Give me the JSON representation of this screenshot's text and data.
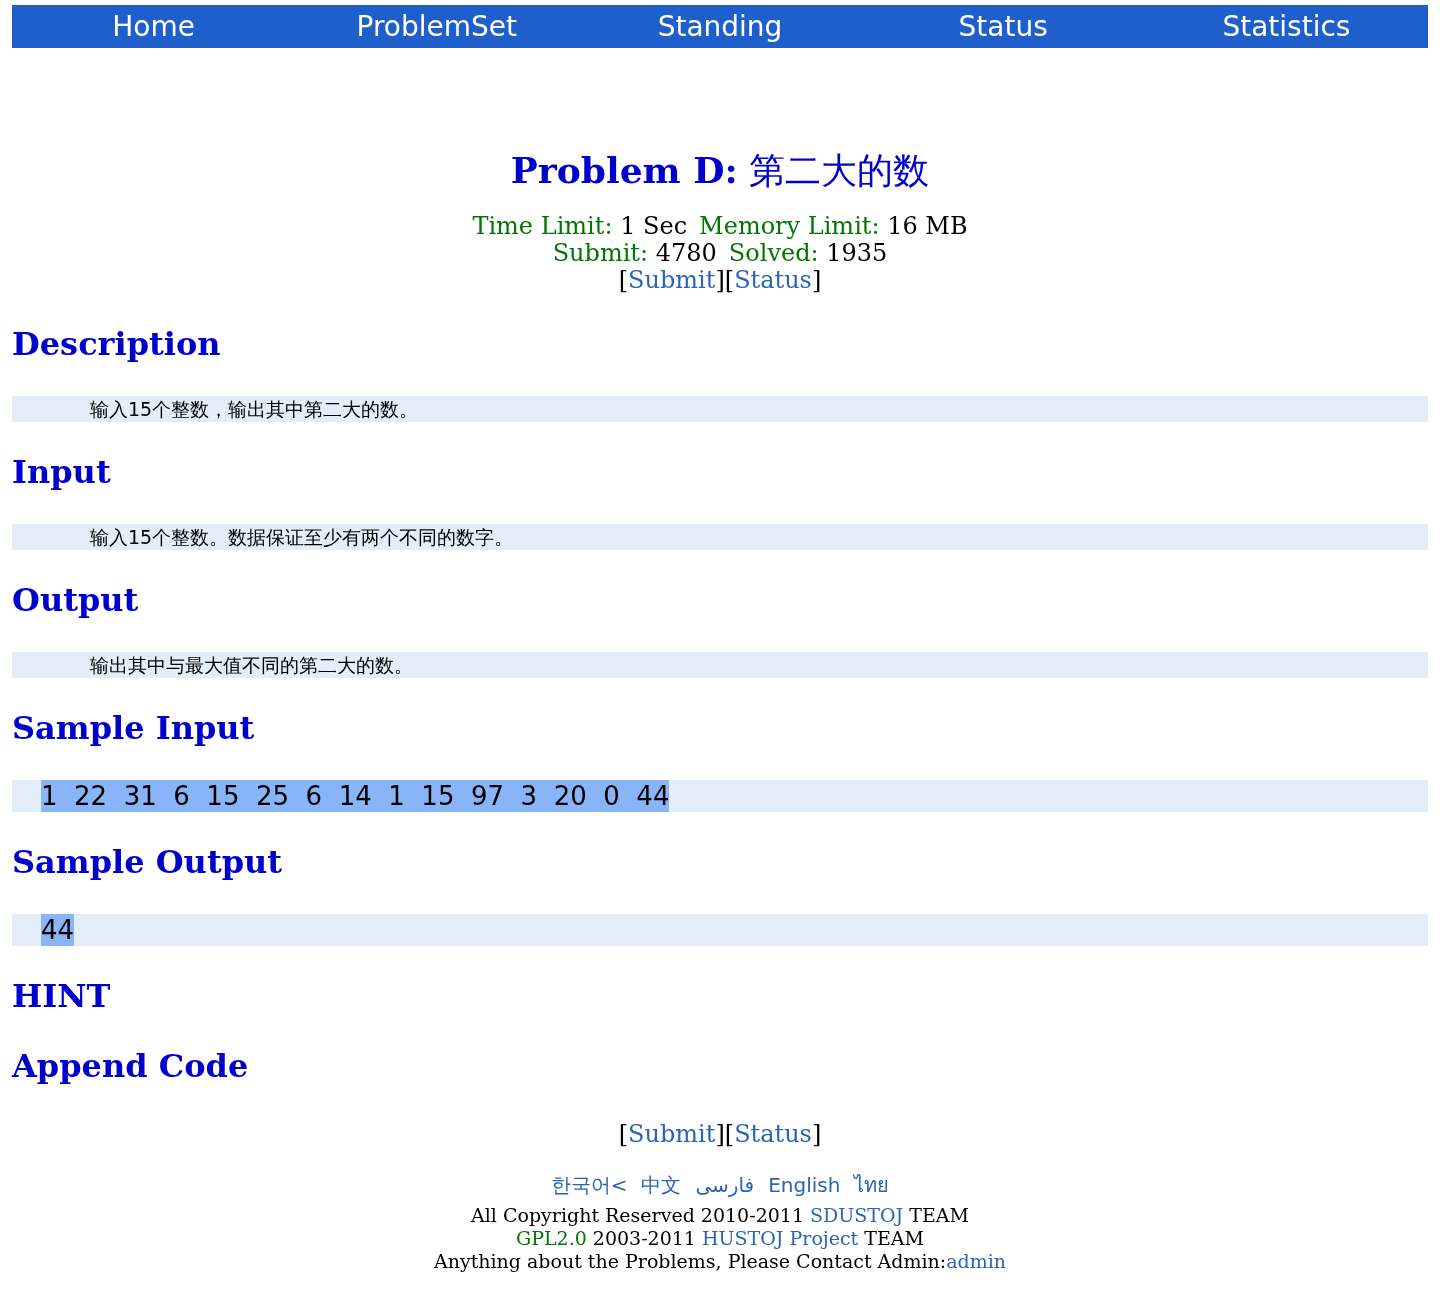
{
  "nav": [
    {
      "label": "Home"
    },
    {
      "label": "ProblemSet"
    },
    {
      "label": "Standing"
    },
    {
      "label": "Status"
    },
    {
      "label": "Statistics"
    }
  ],
  "problem": {
    "title_prefix": "Problem D:",
    "title": "第二大的数",
    "limits": [
      {
        "label": "Time Limit:",
        "value": "1 Sec"
      },
      {
        "label": "Memory Limit:",
        "value": "16 MB"
      }
    ],
    "counts": [
      {
        "label": "Submit:",
        "value": "4780"
      },
      {
        "label": "Solved:",
        "value": "1935"
      }
    ],
    "links": [
      {
        "kind": "bracket",
        "text": "["
      },
      {
        "kind": "link",
        "text": "Submit"
      },
      {
        "kind": "bracket",
        "text": "]["
      },
      {
        "kind": "link",
        "text": "Status"
      },
      {
        "kind": "bracket",
        "text": "]"
      }
    ]
  },
  "sections": [
    {
      "kind": "text",
      "heading": "Description",
      "body": "输入15个整数，输出其中第二大的数。"
    },
    {
      "kind": "text",
      "heading": "Input",
      "body": "输入15个整数。数据保证至少有两个不同的数字。"
    },
    {
      "kind": "text",
      "heading": "Output",
      "body": "输出其中与最大值不同的第二大的数。"
    },
    {
      "kind": "sample",
      "heading": "Sample Input",
      "body": "1  22  31  6  15  25  6  14  1  15  97  3  20  0  44",
      "highlighted": true
    },
    {
      "kind": "sample",
      "heading": "Sample Output",
      "body": "44",
      "highlighted": true
    },
    {
      "kind": "heading",
      "heading": "HINT"
    },
    {
      "kind": "heading",
      "heading": "Append Code"
    }
  ],
  "bottom_links": [
    {
      "kind": "bracket",
      "text": "["
    },
    {
      "kind": "link",
      "text": "Submit"
    },
    {
      "kind": "bracket",
      "text": "]["
    },
    {
      "kind": "link",
      "text": "Status"
    },
    {
      "kind": "bracket",
      "text": "]"
    }
  ],
  "footer": {
    "languages": [
      "한국어<",
      "中文",
      "فارسی",
      "English",
      "ไทย"
    ],
    "copyright": {
      "text": "All Copyright Reserved 2010-2011",
      "link": "SDUSTOJ",
      "suffix": "TEAM"
    },
    "license": {
      "link": "GPL2.0",
      "text": "2003-2011",
      "project": "HUSTOJ Project",
      "suffix": "TEAM"
    },
    "contact": {
      "text": "Anything about the Problems, Please Contact Admin:",
      "link": "admin"
    }
  }
}
